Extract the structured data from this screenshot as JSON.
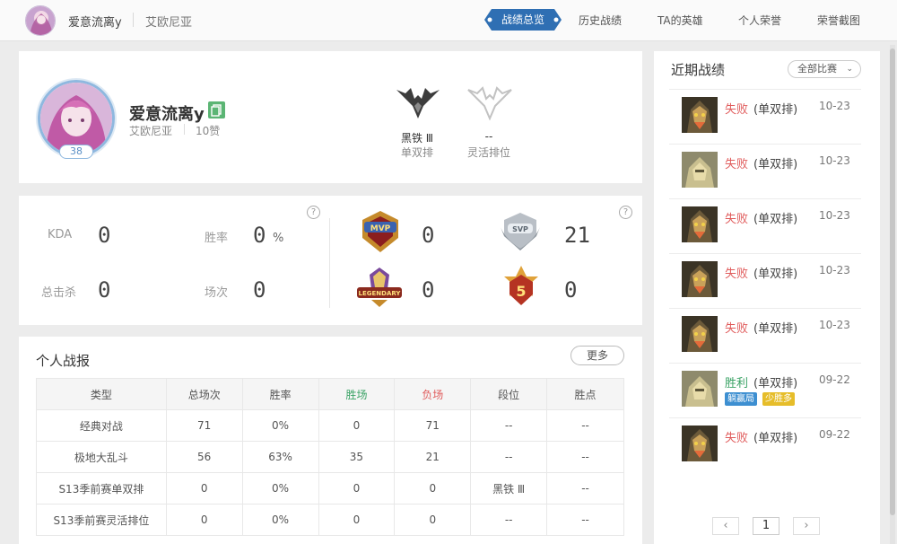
{
  "topbar": {
    "player_name": "爱意流离y",
    "region": "艾欧尼亚",
    "tabs": [
      "战绩总览",
      "历史战绩",
      "TA的英雄",
      "个人荣誉",
      "荣誉截图"
    ],
    "active_tab": "战绩总览"
  },
  "profile": {
    "name": "爱意流离y",
    "region": "艾欧尼亚",
    "likes": "10赞",
    "level": "38",
    "ranks": [
      {
        "tier": "黑铁 Ⅲ",
        "queue": "单双排"
      },
      {
        "tier": "--",
        "queue": "灵活排位"
      }
    ]
  },
  "stats": {
    "kda_label": "KDA",
    "kda": "0",
    "winrate_label": "胜率",
    "winrate": "0",
    "winrate_unit": "%",
    "kills_label": "总击杀",
    "kills": "0",
    "games_label": "场次",
    "games": "0",
    "help": "?",
    "honors": [
      {
        "icon": "mvp-badge-icon",
        "value": "0"
      },
      {
        "icon": "svp-badge-icon",
        "value": "21"
      },
      {
        "icon": "legendary-badge-icon",
        "value": "0"
      },
      {
        "icon": "pentakill-badge-icon",
        "value": "0"
      }
    ]
  },
  "report": {
    "title": "个人战报",
    "more": "更多",
    "headers": [
      "类型",
      "总场次",
      "胜率",
      "胜场",
      "负场",
      "段位",
      "胜点"
    ],
    "rows": [
      [
        "经典对战",
        "71",
        "0%",
        "0",
        "71",
        "--",
        "--"
      ],
      [
        "极地大乱斗",
        "56",
        "63%",
        "35",
        "21",
        "--",
        "--"
      ],
      [
        "S13季前赛单双排",
        "0",
        "0%",
        "0",
        "0",
        "黑铁 Ⅲ",
        "--"
      ],
      [
        "S13季前赛灵活排位",
        "0",
        "0%",
        "0",
        "0",
        "--",
        "--"
      ]
    ],
    "colors": {
      "win_header": "#3aa265",
      "loss_header": "#e05b5b"
    }
  },
  "recent": {
    "title": "近期战绩",
    "filter": "全部比赛",
    "matches": [
      {
        "result": "失败",
        "mode": "(单双排)",
        "date": "10-23",
        "champ": "warwick-icon",
        "tags": []
      },
      {
        "result": "失败",
        "mode": "(单双排)",
        "date": "10-23",
        "champ": "malphite-icon",
        "tags": []
      },
      {
        "result": "失败",
        "mode": "(单双排)",
        "date": "10-23",
        "champ": "warwick-icon",
        "tags": []
      },
      {
        "result": "失败",
        "mode": "(单双排)",
        "date": "10-23",
        "champ": "warwick-icon",
        "tags": []
      },
      {
        "result": "失败",
        "mode": "(单双排)",
        "date": "10-23",
        "champ": "warwick-icon",
        "tags": []
      },
      {
        "result": "胜利",
        "mode": "(单双排)",
        "date": "09-22",
        "champ": "malphite-icon",
        "tags": [
          "躺赢局",
          "少胜多"
        ]
      },
      {
        "result": "失败",
        "mode": "(单双排)",
        "date": "09-22",
        "champ": "warwick-icon",
        "tags": []
      }
    ],
    "pager": {
      "prev": "‹",
      "page": "1",
      "next": "›"
    }
  }
}
